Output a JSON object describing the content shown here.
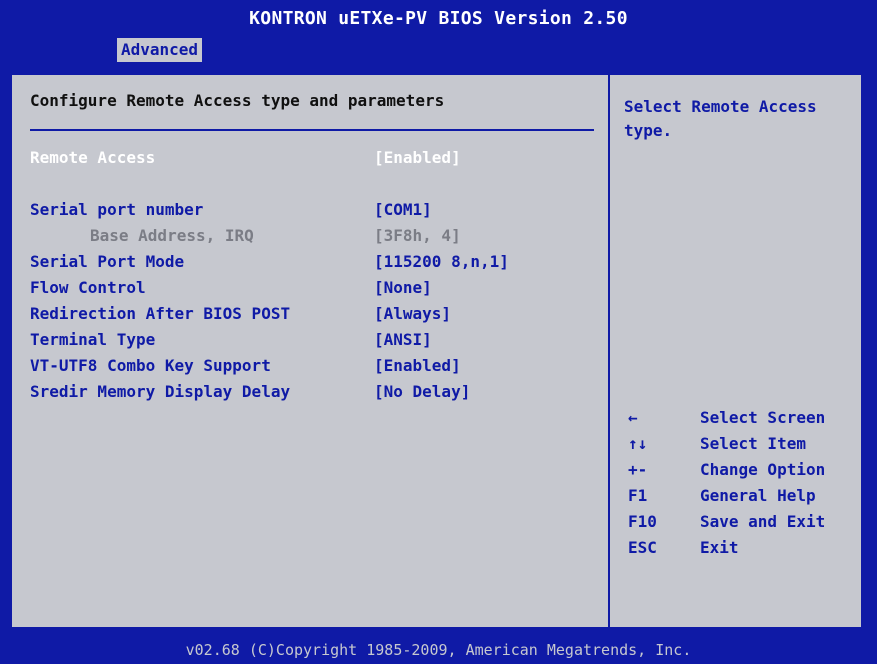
{
  "title": "KONTRON uETXe-PV BIOS Version 2.50",
  "tab": "Advanced",
  "main": {
    "heading": "Configure Remote Access type and parameters",
    "settings": [
      {
        "label": "Remote Access",
        "value": "[Enabled]",
        "state": "active"
      },
      {
        "label": "Serial port number",
        "value": "[COM1]",
        "state": "normal"
      },
      {
        "label": "Base Address, IRQ",
        "value": "[3F8h, 4]",
        "state": "disabled"
      },
      {
        "label": "Serial Port Mode",
        "value": "[115200 8,n,1]",
        "state": "normal"
      },
      {
        "label": "Flow Control",
        "value": "[None]",
        "state": "normal"
      },
      {
        "label": "Redirection After BIOS POST",
        "value": "[Always]",
        "state": "normal"
      },
      {
        "label": "Terminal Type",
        "value": "[ANSI]",
        "state": "normal"
      },
      {
        "label": "VT-UTF8 Combo Key Support",
        "value": "[Enabled]",
        "state": "normal"
      },
      {
        "label": "Sredir Memory Display Delay",
        "value": "[No Delay]",
        "state": "normal"
      }
    ]
  },
  "help": {
    "text": "Select Remote Access type.",
    "keys": [
      {
        "key": "←",
        "desc": "Select Screen"
      },
      {
        "key": "↑↓",
        "desc": "Select Item"
      },
      {
        "key": "+-",
        "desc": "Change Option"
      },
      {
        "key": "F1",
        "desc": "General Help"
      },
      {
        "key": "F10",
        "desc": "Save and Exit"
      },
      {
        "key": "ESC",
        "desc": "Exit"
      }
    ]
  },
  "footer": "v02.68 (C)Copyright 1985-2009, American Megatrends, Inc.",
  "colors": {
    "background": "#0f1aa6",
    "panel": "#c6c8cf",
    "highlight": "#ffffff",
    "disabled": "#7b7d86"
  }
}
